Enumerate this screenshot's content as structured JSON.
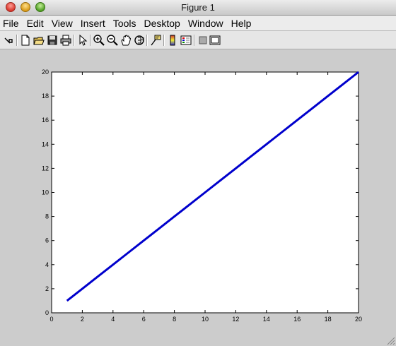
{
  "window": {
    "title": "Figure 1"
  },
  "menu": [
    "File",
    "Edit",
    "View",
    "Insert",
    "Tools",
    "Desktop",
    "Window",
    "Help"
  ],
  "toolbar": [
    "dock-arrow-icon",
    "new-figure-icon",
    "open-file-icon",
    "save-icon",
    "print-icon",
    "pointer-icon",
    "zoom-in-icon",
    "zoom-out-icon",
    "pan-hand-icon",
    "rotate-3d-icon",
    "data-cursor-icon",
    "colorbar-icon",
    "legend-icon",
    "hide-plot-tools-icon",
    "show-plot-tools-icon"
  ],
  "chart_data": {
    "type": "line",
    "x": [
      1,
      2,
      3,
      4,
      5,
      6,
      7,
      8,
      9,
      10,
      11,
      12,
      13,
      14,
      15,
      16,
      17,
      18,
      19,
      20
    ],
    "series": [
      {
        "values": [
          1,
          2,
          3,
          4,
          5,
          6,
          7,
          8,
          9,
          10,
          11,
          12,
          13,
          14,
          15,
          16,
          17,
          18,
          19,
          20
        ],
        "color": "#0000cc"
      }
    ],
    "xlim": [
      0,
      20
    ],
    "ylim": [
      0,
      20
    ],
    "xticks": [
      "0",
      "2",
      "4",
      "6",
      "8",
      "10",
      "12",
      "14",
      "16",
      "18",
      "20"
    ],
    "yticks": [
      "0",
      "2",
      "4",
      "6",
      "8",
      "10",
      "12",
      "14",
      "16",
      "18",
      "20"
    ],
    "grid": false
  }
}
